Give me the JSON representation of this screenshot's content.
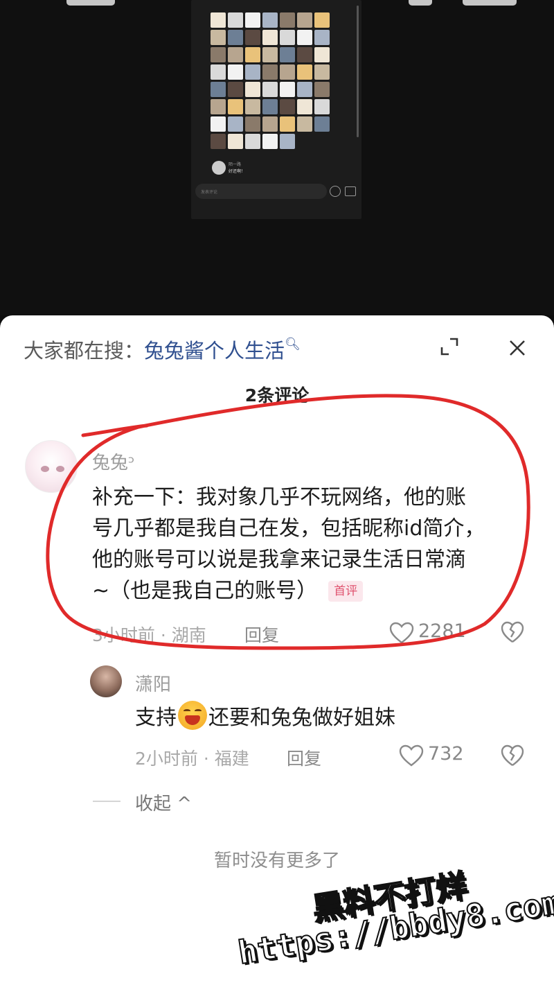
{
  "sheet": {
    "search_prefix": "大家都在搜：",
    "search_keyword": "兔兔酱个人生活",
    "comment_count": "2条评论"
  },
  "comments": [
    {
      "username": "兔兔ᵓ",
      "lines": [
        "补充一下：我对象几乎不玩网络，他的账",
        "号几乎都是我自己在发，包括昵称id简介，",
        "他的账号可以说是我拿来记录生活日常滴",
        "~（也是我自己的账号）"
      ],
      "badge": "首评",
      "meta": "3小时前 · 湖南",
      "reply_label": "回复",
      "likes": "2281"
    },
    {
      "username": "潇阳",
      "text_before_emoji": "支持",
      "text_after_emoji": "还要和兔兔做好姐妹",
      "meta": "2小时前 · 福建",
      "reply_label": "回复",
      "likes": "732"
    }
  ],
  "collapse_label": "收起 ^",
  "no_more_label": "暂时没有更多了",
  "watermark": {
    "line1": "黑料不打烊",
    "line2": "https://bbdy8.com"
  },
  "embedded_screenshot": {
    "input_placeholder": "发表评论",
    "comment_user": "陌一路",
    "comment_text": "好还啊！"
  },
  "colors": {
    "keyword": "#2f4f8f",
    "annotation": "#e02a2a",
    "badge": "#e0536f"
  }
}
